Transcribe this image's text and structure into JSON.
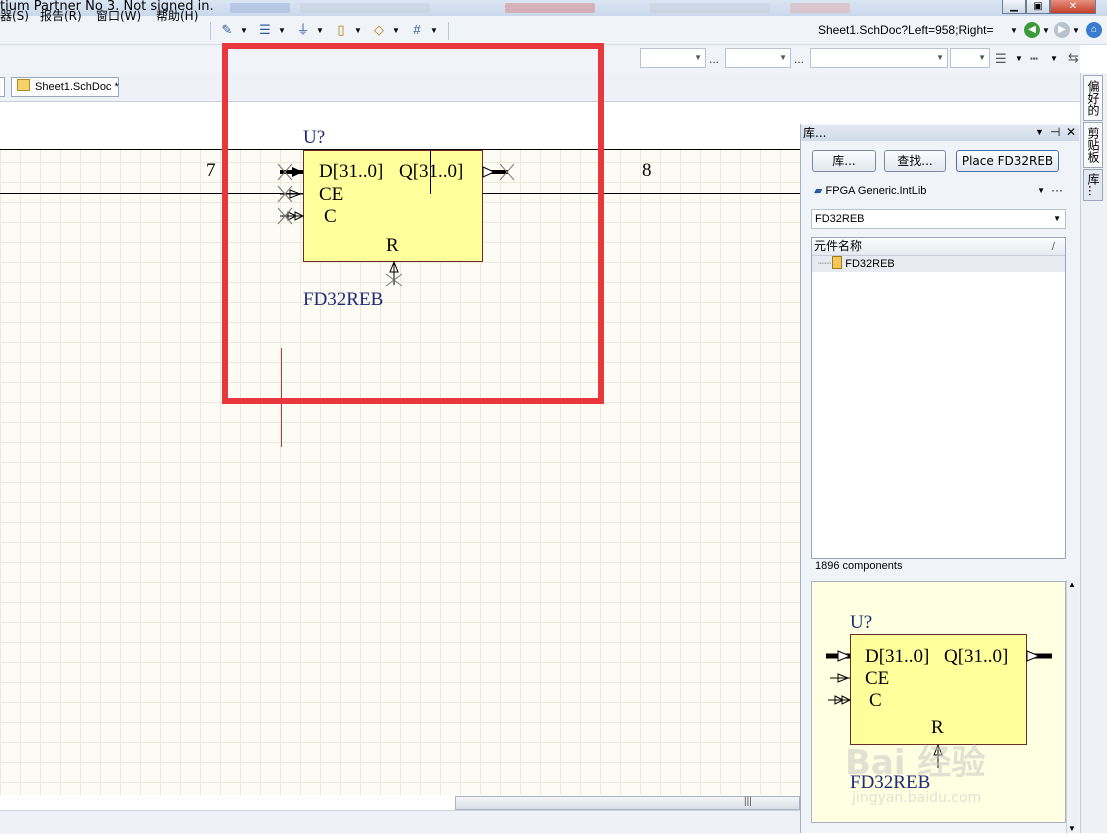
{
  "window": {
    "title_text": "tium Partner No 3. Not signed in."
  },
  "menu": {
    "items": [
      "器(S)",
      "报告(R)",
      "窗口(W)",
      "帮助(H)"
    ]
  },
  "address_bar": {
    "value": "Sheet1.SchDoc?Left=958;Right="
  },
  "tabs": {
    "document_tab": "Sheet1.SchDoc *"
  },
  "canvas": {
    "zone_left": "7",
    "zone_right": "8",
    "component": {
      "designator": "U?",
      "pin_d": "D[31..0]",
      "pin_q": "Q[31..0]",
      "pin_ce": "CE",
      "pin_c": "C",
      "pin_r": "R",
      "comment": "FD32REB"
    }
  },
  "library_panel": {
    "title": "库...",
    "buttons": {
      "library": "库...",
      "search": "查找...",
      "place": "Place FD32REB"
    },
    "library_select": "FPGA Generic.IntLib",
    "filter_value": "FD32REB",
    "list_header": "元件名称",
    "list_items": [
      "FD32REB"
    ],
    "component_count": "1896 components",
    "preview": {
      "designator": "U?",
      "pin_d": "D[31..0]",
      "pin_q": "Q[31..0]",
      "pin_ce": "CE",
      "pin_c": "C",
      "pin_r": "R",
      "comment": "FD32REB"
    }
  },
  "side_tabs": [
    "偏好的",
    "剪贴板",
    "库..."
  ],
  "watermark": {
    "brand": "Bai 经验",
    "url": "jingyan.baidu.com"
  }
}
